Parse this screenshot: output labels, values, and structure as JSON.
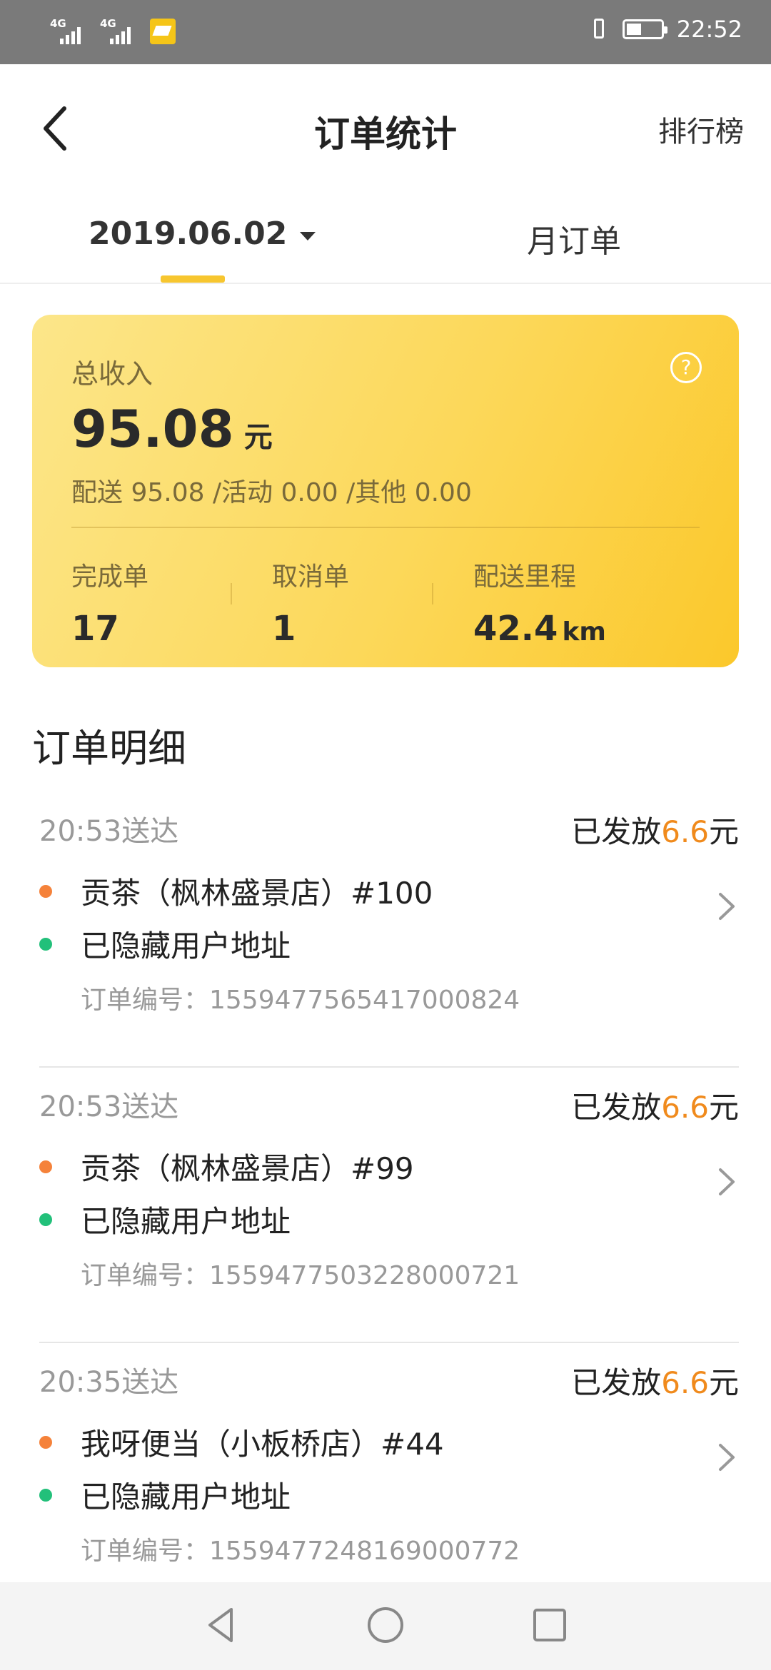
{
  "status_bar": {
    "signal1": "4G",
    "signal2": "4G",
    "time": "22:52"
  },
  "header": {
    "title": "订单统计",
    "right_action": "排行榜"
  },
  "tabs": {
    "date": "2019.06.02",
    "month": "月订单"
  },
  "summary": {
    "total_label": "总收入",
    "total_amount": "95.08",
    "total_unit": "元",
    "breakdown": "配送 95.08  /活动 0.00  /其他 0.00",
    "completed_label": "完成单",
    "completed_value": "17",
    "cancelled_label": "取消单",
    "cancelled_value": "1",
    "distance_label": "配送里程",
    "distance_value": "42.4",
    "distance_unit": "km"
  },
  "details_title": "订单明细",
  "orders": [
    {
      "time": "20:53送达",
      "paid_prefix": "已发放",
      "paid_amount": "6.6",
      "paid_unit": "元",
      "store": "贡茶（枫林盛景店）#100",
      "address": "已隐藏用户地址",
      "order_no": "订单编号：1559477565417000824"
    },
    {
      "time": "20:53送达",
      "paid_prefix": "已发放",
      "paid_amount": "6.6",
      "paid_unit": "元",
      "store": "贡茶（枫林盛景店）#99",
      "address": "已隐藏用户地址",
      "order_no": "订单编号：1559477503228000721"
    },
    {
      "time": "20:35送达",
      "paid_prefix": "已发放",
      "paid_amount": "6.6",
      "paid_unit": "元",
      "store": "我呀便当（小板桥店）#44",
      "address": "已隐藏用户地址",
      "order_no": "订单编号：1559477248169000772"
    }
  ],
  "colors": {
    "accent_yellow": "#f7c62f",
    "amount_orange": "#f08a1c",
    "dot_orange": "#f5823a",
    "dot_green": "#22c07a"
  },
  "icons": [
    "back-arrow-icon",
    "dropdown-caret-icon",
    "help-icon",
    "chevron-right-icon",
    "nav-back-icon",
    "nav-home-icon",
    "nav-recents-icon"
  ]
}
